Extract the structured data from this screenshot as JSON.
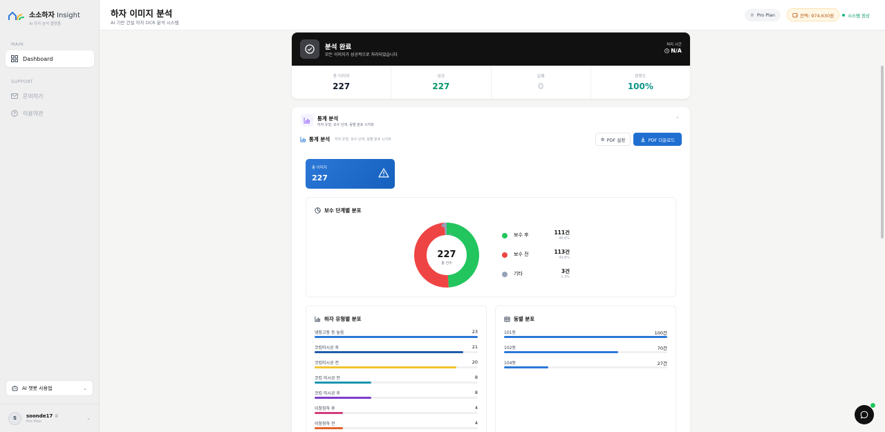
{
  "brand": {
    "name_bold": "소소하자",
    "name_light": " Insight",
    "subtitle": "AI 하자 분석 플랫폼"
  },
  "sidebar": {
    "main_label": "MAIN",
    "support_label": "SUPPORT",
    "items": [
      {
        "label": "Dashboard",
        "icon": "grid-icon",
        "active": true
      },
      {
        "label": "문의하기",
        "icon": "mail-icon",
        "active": false
      },
      {
        "label": "이용약관",
        "icon": "help-icon",
        "active": false
      }
    ],
    "bot_guide": "AI 챗봇 사용법",
    "user": {
      "initial": "S",
      "name": "soonde17",
      "plan": "Pro Plan"
    }
  },
  "header": {
    "title": "하자 이미지 분석",
    "subtitle": "AI 기반 건설 하자 OCR 분석 시스템",
    "plan": "Pro Plan",
    "balance": "잔액: 974,630원",
    "status": "시스템 정상",
    "status_color": "#10b981"
  },
  "complete": {
    "title": "분석 완료",
    "subtitle": "모든 이미지가 성공적으로 처리되었습니다",
    "proc_label": "처리 시간",
    "proc_value": "N/A",
    "stats": [
      {
        "label": "총 이미지",
        "value": "227",
        "color": "#111827"
      },
      {
        "label": "성공",
        "value": "227",
        "color": "#059669"
      },
      {
        "label": "실패",
        "value": "0",
        "color": "#d1d5db"
      },
      {
        "label": "정확도",
        "value": "100%",
        "color": "#0d9488"
      }
    ]
  },
  "panel": {
    "title": "통계 분석",
    "subtitle": "하자 유형, 보수 단계, 동별 분포 시각화",
    "inner_title": "통계 분석",
    "inner_subtitle": "하자 유형, 보수 단계, 동별 분포 시각화",
    "pdf_settings": "PDF 설정",
    "pdf_download": "PDF 다운로드",
    "total_label": "총 이미지",
    "total_value": "227"
  },
  "repair_chart": {
    "title": "보수 단계별 분포",
    "center_value": "227",
    "center_label": "총 건수",
    "slices": [
      {
        "name": "보수 후",
        "count": "111건",
        "pct": "48.9%",
        "value": 111,
        "color": "#22c55e"
      },
      {
        "name": "보수 전",
        "count": "113건",
        "pct": "49.8%",
        "value": 113,
        "color": "#ef4444"
      },
      {
        "name": "기타",
        "count": "3건",
        "pct": "1.3%",
        "value": 3,
        "color": "#94a3b8"
      }
    ]
  },
  "defect_chart": {
    "title": "하자 유형별 분포",
    "max": 23,
    "bars": [
      {
        "label": "냉장고장 등 높음",
        "value": 23,
        "color": "#2b78d8"
      },
      {
        "label": "코킹미시공 후",
        "value": 21,
        "color": "#1e5aa8"
      },
      {
        "label": "코킹미시공 전",
        "value": 20,
        "color": "#f2c230"
      },
      {
        "label": "코킹 미시공 전",
        "value": 8,
        "color": "#1a95b0"
      },
      {
        "label": "코킹 미시공 후",
        "value": 8,
        "color": "#7c3fc8"
      },
      {
        "label": "이창칭하 후",
        "value": 4,
        "color": "#d33c7a"
      },
      {
        "label": "이창칭하 전",
        "value": 4,
        "color": "#e2622a"
      }
    ]
  },
  "dong_chart": {
    "title": "동별 분포",
    "max": 100,
    "bars": [
      {
        "label": "101동",
        "display": "100건",
        "value": 100,
        "color": "#2b78d8"
      },
      {
        "label": "102동",
        "display": "70건",
        "value": 70,
        "color": "#2b78d8"
      },
      {
        "label": "104동",
        "display": "27건",
        "value": 27,
        "color": "#2b78d8"
      }
    ]
  }
}
